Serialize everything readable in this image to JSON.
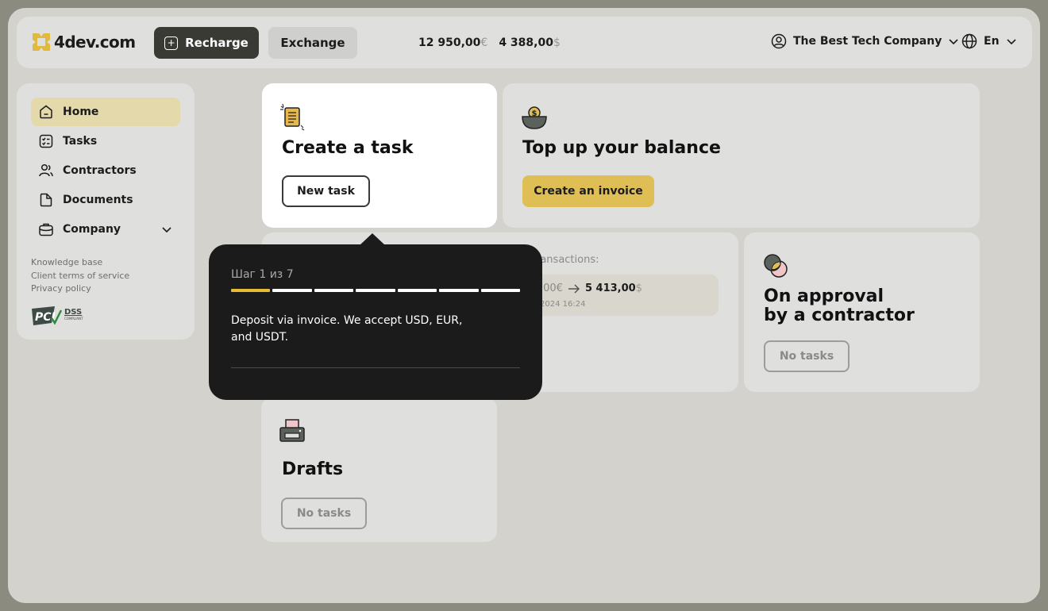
{
  "header": {
    "logo_text": "4dev.com",
    "recharge_label": "Recharge",
    "exchange_label": "Exchange",
    "balance_eur": "12 950,00",
    "balance_eur_symbol": "€",
    "balance_usd": "4 388,00",
    "balance_usd_symbol": "$",
    "company_name": "The Best Tech Company",
    "language": "En"
  },
  "sidebar": {
    "items": [
      {
        "label": "Home",
        "icon": "home-icon",
        "active": true
      },
      {
        "label": "Tasks",
        "icon": "tasks-icon"
      },
      {
        "label": "Contractors",
        "icon": "contractors-icon"
      },
      {
        "label": "Documents",
        "icon": "document-icon"
      },
      {
        "label": "Company",
        "icon": "briefcase-icon",
        "expandable": true
      }
    ],
    "links": [
      "Knowledge base",
      "Client terms of service",
      "Privacy policy"
    ],
    "pci_badge": {
      "big": "PCI",
      "small": "DSS",
      "tiny": "COMPLIANT"
    }
  },
  "cards": {
    "create_task": {
      "title": "Create a task",
      "button": "New task"
    },
    "top_up": {
      "title": "Top up your balance",
      "button": "Create an invoice"
    },
    "transactions": {
      "label": "ransactions:",
      "amount_from": ",00€",
      "amount_to": "5 413,00",
      "amount_to_symbol": "$",
      "date": "2024 16:24"
    },
    "approval": {
      "title_line1": "On approval",
      "title_line2": "by a contractor",
      "button": "No tasks"
    },
    "drafts": {
      "title": "Drafts",
      "button": "No tasks"
    }
  },
  "tooltip": {
    "step": "Шаг 1 из 7",
    "step_current": 1,
    "step_total": 7,
    "text": "Deposit via invoice. We accept USD, EUR, and USDT."
  },
  "colors": {
    "accent_yellow": "#e0be56",
    "dark_button": "#3a3a34",
    "active_nav": "#e4d9aa",
    "tooltip_bg": "#1b1b1b"
  }
}
